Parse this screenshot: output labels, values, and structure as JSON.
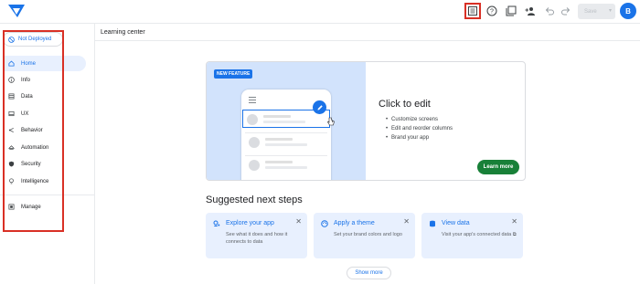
{
  "topbar": {
    "save_label": "Save",
    "avatar_initial": "B"
  },
  "sidebar": {
    "deploy_label": "Not Deployed",
    "items": [
      {
        "label": "Home",
        "icon": "home-icon"
      },
      {
        "label": "Info",
        "icon": "info-icon"
      },
      {
        "label": "Data",
        "icon": "data-icon"
      },
      {
        "label": "UX",
        "icon": "ux-icon"
      },
      {
        "label": "Behavior",
        "icon": "behavior-icon"
      },
      {
        "label": "Automation",
        "icon": "automation-icon"
      },
      {
        "label": "Security",
        "icon": "security-icon"
      },
      {
        "label": "Intelligence",
        "icon": "intelligence-icon"
      },
      {
        "label": "Manage",
        "icon": "manage-icon"
      }
    ]
  },
  "main": {
    "title": "Learning center",
    "feature": {
      "badge": "NEW FEATURE",
      "title": "Click to edit",
      "bullets": [
        "Customize screens",
        "Edit and reorder columns",
        "Brand your app"
      ],
      "cta": "Learn more"
    },
    "steps_title": "Suggested next steps",
    "steps": [
      {
        "title": "Explore your app",
        "desc": "See what it does and how it connects to data"
      },
      {
        "title": "Apply a theme",
        "desc": "Set your brand colors and logo"
      },
      {
        "title": "View data",
        "desc": "Visit your app's connected data ⧉"
      }
    ],
    "show_more": "Show more"
  },
  "colors": {
    "accent": "#1a73e8",
    "highlight": "#d93025",
    "cta": "#188038"
  }
}
